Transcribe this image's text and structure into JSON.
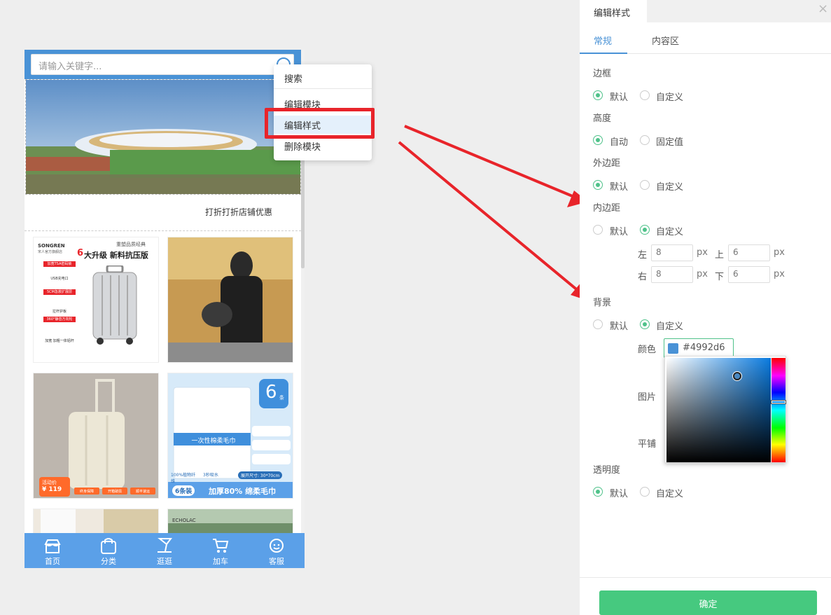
{
  "phone": {
    "search": {
      "placeholder": "请输入关键字..."
    },
    "notice": "打折打折店铺优惠",
    "products": [
      {
        "brand": "SONGREN",
        "brand_sub": "宋人官方旗舰店",
        "tag": "重塑品质经典",
        "headline_num": "6",
        "headline": "大升级 新料抗压版",
        "features": [
          "加宽TSA密码锁",
          "USB充电口",
          "5CM急救扩展层",
          "拉杆护板",
          "360°静音万向轮",
          "加宽 加粗一体铝杆"
        ]
      },
      {
        "alt": "person-with-bag"
      },
      {
        "badge": "活动价",
        "price": "¥ 119",
        "chips": [
          "终身保障",
          "开箱破损",
          "顺丰速运"
        ]
      },
      {
        "badge_num": "6",
        "badge_unit": "条",
        "package_title": "一次性棉柔毛巾",
        "feature_a": "100%植物纤维",
        "feature_b": "3秒吸水",
        "size_text": "展开尺寸: 30*70cm",
        "bottom_tag": "6条装",
        "bottom_text": "加厚80% 绵柔毛巾"
      },
      {
        "alt": "room"
      },
      {
        "brand": "ECHOLAC"
      }
    ],
    "tabbar": [
      {
        "label": "首页",
        "icon": "store-icon"
      },
      {
        "label": "分类",
        "icon": "bag-icon"
      },
      {
        "label": "逛逛",
        "icon": "lamp-icon"
      },
      {
        "label": "加车",
        "icon": "cart-icon"
      },
      {
        "label": "客服",
        "icon": "service-icon"
      }
    ]
  },
  "context_menu": {
    "items": [
      "搜索",
      "编辑模块",
      "编辑样式",
      "删除模块"
    ],
    "highlighted": "编辑样式"
  },
  "panel": {
    "tab": "编辑样式",
    "close": "×",
    "subtabs": [
      "常规",
      "内容区"
    ],
    "active_subtab": "常规",
    "border": {
      "label": "边框",
      "options": [
        "默认",
        "自定义"
      ],
      "selected": "默认"
    },
    "height": {
      "label": "高度",
      "options": [
        "自动",
        "固定值"
      ],
      "selected": "自动"
    },
    "margin": {
      "label": "外边距",
      "options": [
        "默认",
        "自定义"
      ],
      "selected": "默认"
    },
    "padding": {
      "label": "内边距",
      "options": [
        "默认",
        "自定义"
      ],
      "selected": "自定义",
      "left_label": "左",
      "left": "8",
      "top_label": "上",
      "top": "6",
      "right_label": "右",
      "right": "8",
      "bottom_label": "下",
      "bottom": "6",
      "unit": "px"
    },
    "background": {
      "label": "背景",
      "options": [
        "默认",
        "自定义"
      ],
      "selected": "自定义",
      "color_label": "颜色",
      "color_value": "#4992d6",
      "image_label": "图片",
      "tile_label": "平铺"
    },
    "opacity": {
      "label": "透明度",
      "options": [
        "默认",
        "自定义"
      ],
      "selected": "默认"
    },
    "confirm": "确定"
  },
  "colors": {
    "accent": "#4992d6",
    "green": "#46c97f",
    "highlight_red": "#e8242a",
    "tabbar": "#5ba0e8"
  }
}
